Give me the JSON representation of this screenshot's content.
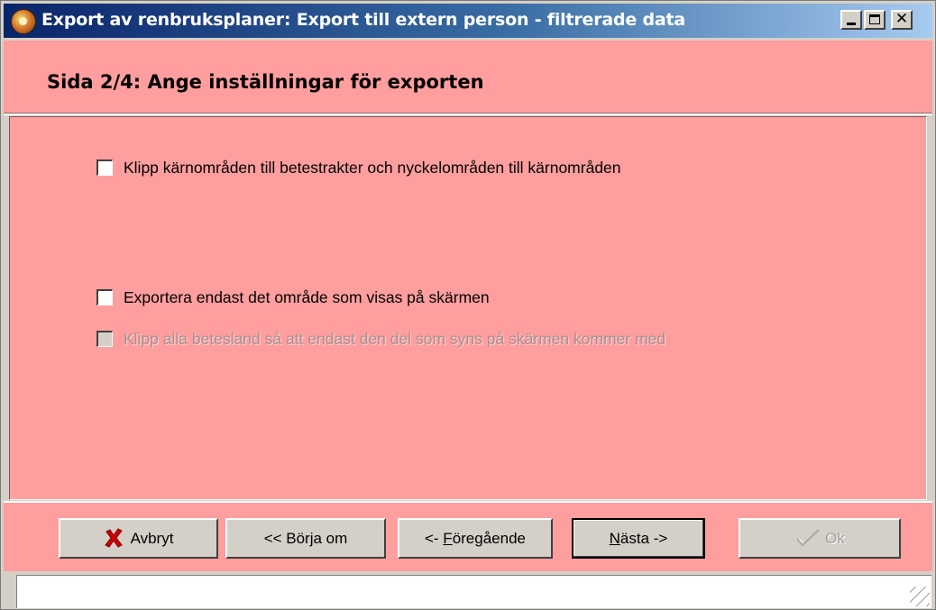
{
  "window": {
    "title": "Export av renbruksplaner: Export till extern person - filtrerade data",
    "app_icon": "reindeer-app-icon",
    "minimize_icon": "minimize-icon",
    "maximize_icon": "maximize-icon",
    "close_icon": "close-icon",
    "close_glyph": "✕"
  },
  "header": {
    "title": "Sida 2/4: Ange inställningar för exporten",
    "background_color": "#ff9e9e"
  },
  "options": [
    {
      "label": "Klipp kärnområden till betestrakter och nyckelområden  till kärnområden",
      "checked": false,
      "enabled": true
    },
    {
      "label": "Exportera endast det område som visas på skärmen",
      "checked": false,
      "enabled": true
    },
    {
      "label": "Klipp alla betesland så att endast den del som syns på skärmen kommer med",
      "checked": false,
      "enabled": false
    }
  ],
  "buttons": {
    "cancel": {
      "label": "Avbryt",
      "icon": "red-x-icon"
    },
    "restart": {
      "label": "<< Börja om"
    },
    "prev": {
      "prefix": "<- ",
      "mnemonic": "F",
      "rest": "öregående"
    },
    "next": {
      "mnemonic": "N",
      "rest": "ästa ->"
    },
    "ok": {
      "label": "Ok",
      "icon": "checkmark-icon",
      "enabled": false
    }
  },
  "statusbar": {
    "text": "",
    "grip_icon": "resize-grip-icon"
  }
}
